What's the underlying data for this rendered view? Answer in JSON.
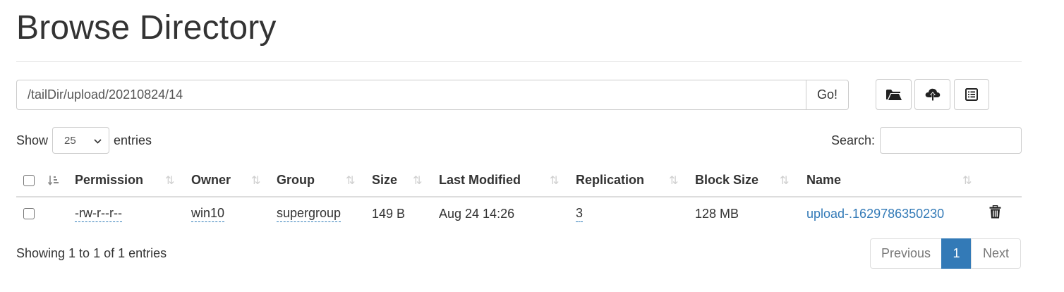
{
  "page": {
    "title": "Browse Directory"
  },
  "path_bar": {
    "path": "/tailDir/upload/20210824/14",
    "go_label": "Go!"
  },
  "toolbar": {
    "icons": [
      "folder-open-icon",
      "cloud-upload-icon",
      "list-alt-icon"
    ]
  },
  "length": {
    "show_label": "Show",
    "value": "25",
    "entries_label": "entries"
  },
  "search": {
    "label": "Search:",
    "value": ""
  },
  "table": {
    "columns": [
      "Permission",
      "Owner",
      "Group",
      "Size",
      "Last Modified",
      "Replication",
      "Block Size",
      "Name"
    ],
    "rows": [
      {
        "permission": "-rw-r--r--",
        "owner": "win10",
        "group": "supergroup",
        "size": "149 B",
        "last_modified": "Aug 24 14:26",
        "replication": "3",
        "block_size": "128 MB",
        "name": "upload-.1629786350230"
      }
    ]
  },
  "info": "Showing 1 to 1 of 1 entries",
  "pagination": {
    "previous": "Previous",
    "current": "1",
    "next": "Next"
  },
  "colors": {
    "accent": "#337ab7",
    "border": "#dddddd",
    "text": "#333333"
  }
}
